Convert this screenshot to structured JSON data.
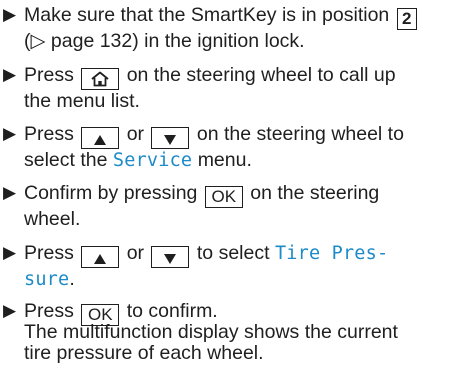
{
  "bullet_symbol": "▶",
  "colors": {
    "text": "#1f1f1f",
    "menu_highlight": "#1c8bc8"
  },
  "steps": [
    {
      "line1_prefix": "Make sure that the SmartKey is in position",
      "position_key": "2",
      "line2": "(▷ page 132) in the ignition lock."
    },
    {
      "line1_prefix": "Press",
      "home_key_icon": "home-icon",
      "line1_suffix": "on the steering wheel to call up",
      "line2": "the menu list."
    },
    {
      "line1_prefix": "Press",
      "up_key_icon": "up-arrow-icon",
      "or_text": "or",
      "down_key_icon": "down-arrow-icon",
      "line1_suffix": "on the steering wheel to",
      "line2_prefix": "select the",
      "menu_name": "Service",
      "line2_suffix": "menu."
    },
    {
      "line1_prefix": "Confirm by pressing",
      "ok_key": "OK",
      "line1_suffix": "on the steering",
      "line2": "wheel."
    },
    {
      "line1_prefix": "Press",
      "up_key_icon": "up-arrow-icon",
      "or_text": "or",
      "down_key_icon": "down-arrow-icon",
      "line1_middle": "to select",
      "menu_line1": "Tire Pres-",
      "menu_line2": "sure",
      "line2_suffix": "."
    },
    {
      "line1_prefix": "Press",
      "ok_key": "OK",
      "line1_suffix": "to confirm.",
      "line2": "The multifunction display shows the current",
      "line3": "tire pressure of each wheel."
    }
  ]
}
